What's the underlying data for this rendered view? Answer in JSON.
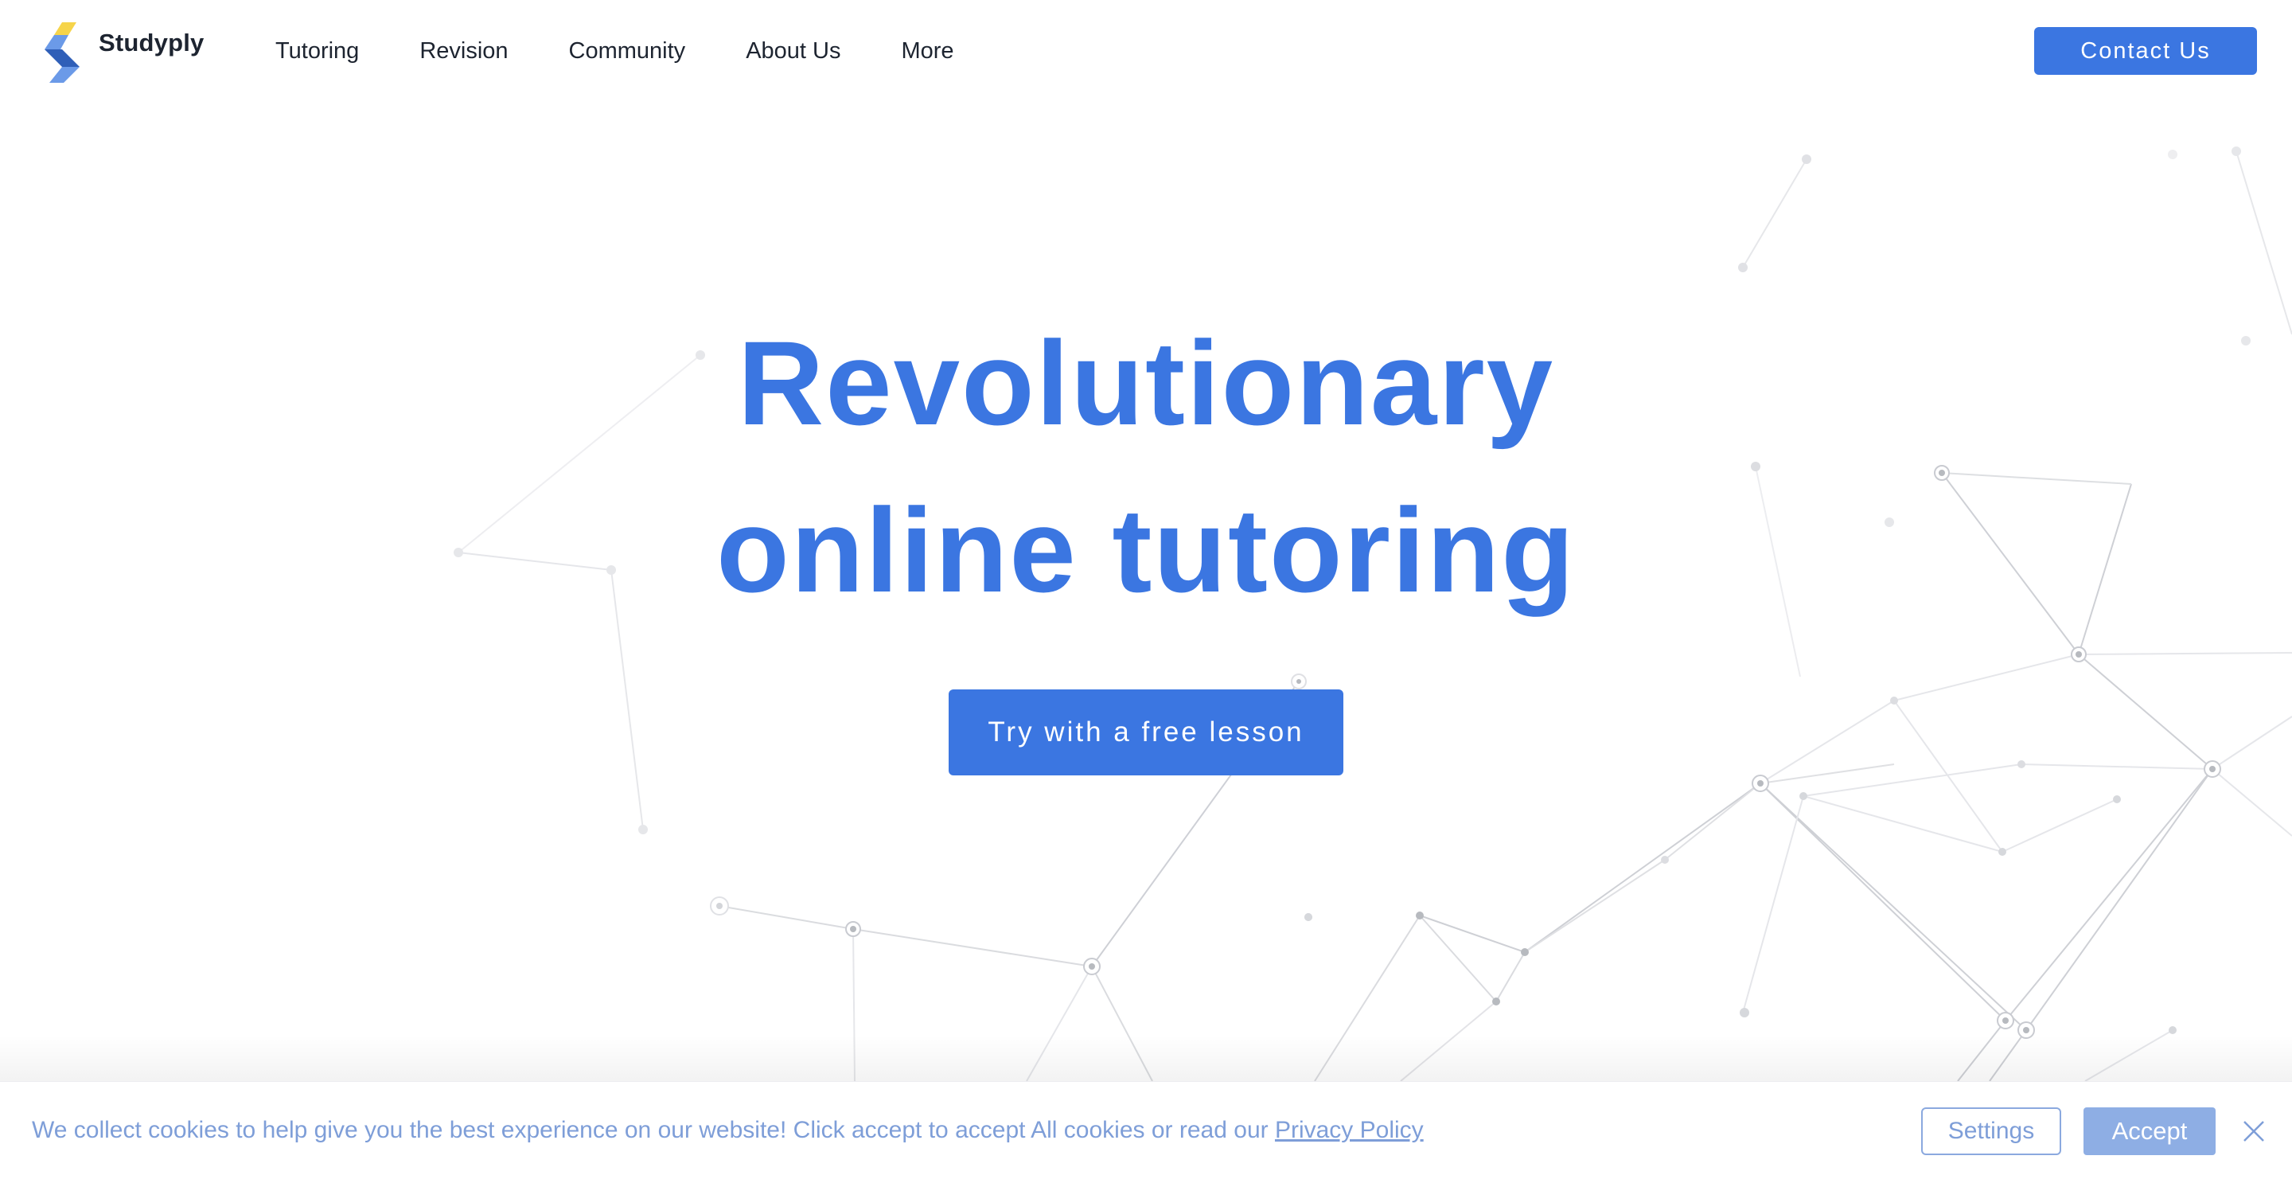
{
  "brand": {
    "name": "Studyply",
    "logo_icon": "s-logo-icon",
    "accent_color": "#3b76e1",
    "logo_yellow": "#f6d44a",
    "logo_blue_dark": "#2f5fb8",
    "logo_blue_light": "#6b9ae8"
  },
  "nav": {
    "items": [
      {
        "label": "Tutoring"
      },
      {
        "label": "Revision"
      },
      {
        "label": "Community"
      },
      {
        "label": "About Us"
      },
      {
        "label": "More"
      }
    ],
    "contact_label": "Contact Us"
  },
  "hero": {
    "title_line1": "Revolutionary",
    "title_line2": "online tutoring",
    "cta_label": "Try with a free lesson"
  },
  "cookie_banner": {
    "message": "We collect cookies to help give you the best experience on our website! Click accept to accept All cookies or read our ",
    "link_label": "Privacy Policy",
    "settings_label": "Settings",
    "accept_label": "Accept",
    "close_icon": "close-icon"
  }
}
